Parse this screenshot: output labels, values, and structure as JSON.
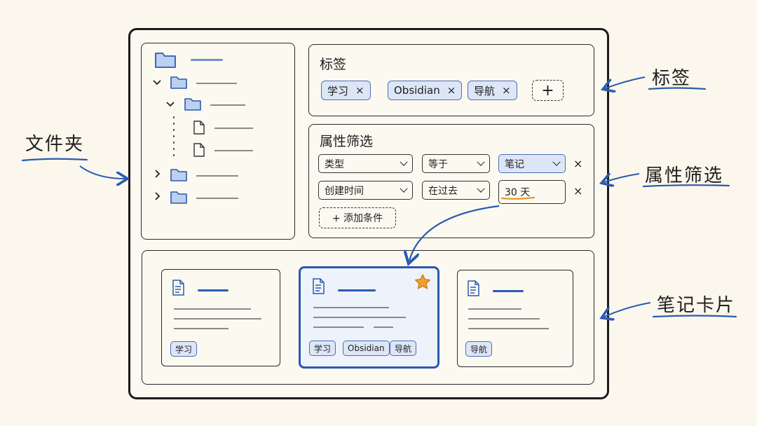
{
  "labels": {
    "folder": "文件夹",
    "tags": "标签",
    "filter": "属性筛选",
    "cards": "笔记卡片"
  },
  "tags_panel": {
    "title": "标签",
    "tags": [
      "学习",
      "Obsidian",
      "导航"
    ],
    "remove_symbol": "×",
    "add_symbol": "+"
  },
  "filter_panel": {
    "title": "属性筛选",
    "rows": [
      {
        "property": "类型",
        "operator": "等于",
        "value": "笔记"
      },
      {
        "property": "创建时间",
        "operator": "在过去",
        "value": "30 天"
      }
    ],
    "remove_symbol": "×",
    "add_condition": "+ 添加条件"
  },
  "cards": [
    {
      "tags": [
        "学习"
      ],
      "starred": false
    },
    {
      "tags": [
        "学习",
        "Obsidian",
        "导航"
      ],
      "starred": true
    },
    {
      "tags": [
        "导航"
      ],
      "starred": false
    }
  ],
  "colors": {
    "accent": "#2b5bb0",
    "tag_fill": "#dde6f7",
    "star": "#f0a030",
    "background": "#fbf7ec"
  },
  "icons": [
    "folder-icon",
    "file-icon",
    "note-icon",
    "star-icon",
    "chevron-down-icon",
    "chevron-right-icon",
    "close-icon",
    "plus-icon"
  ]
}
